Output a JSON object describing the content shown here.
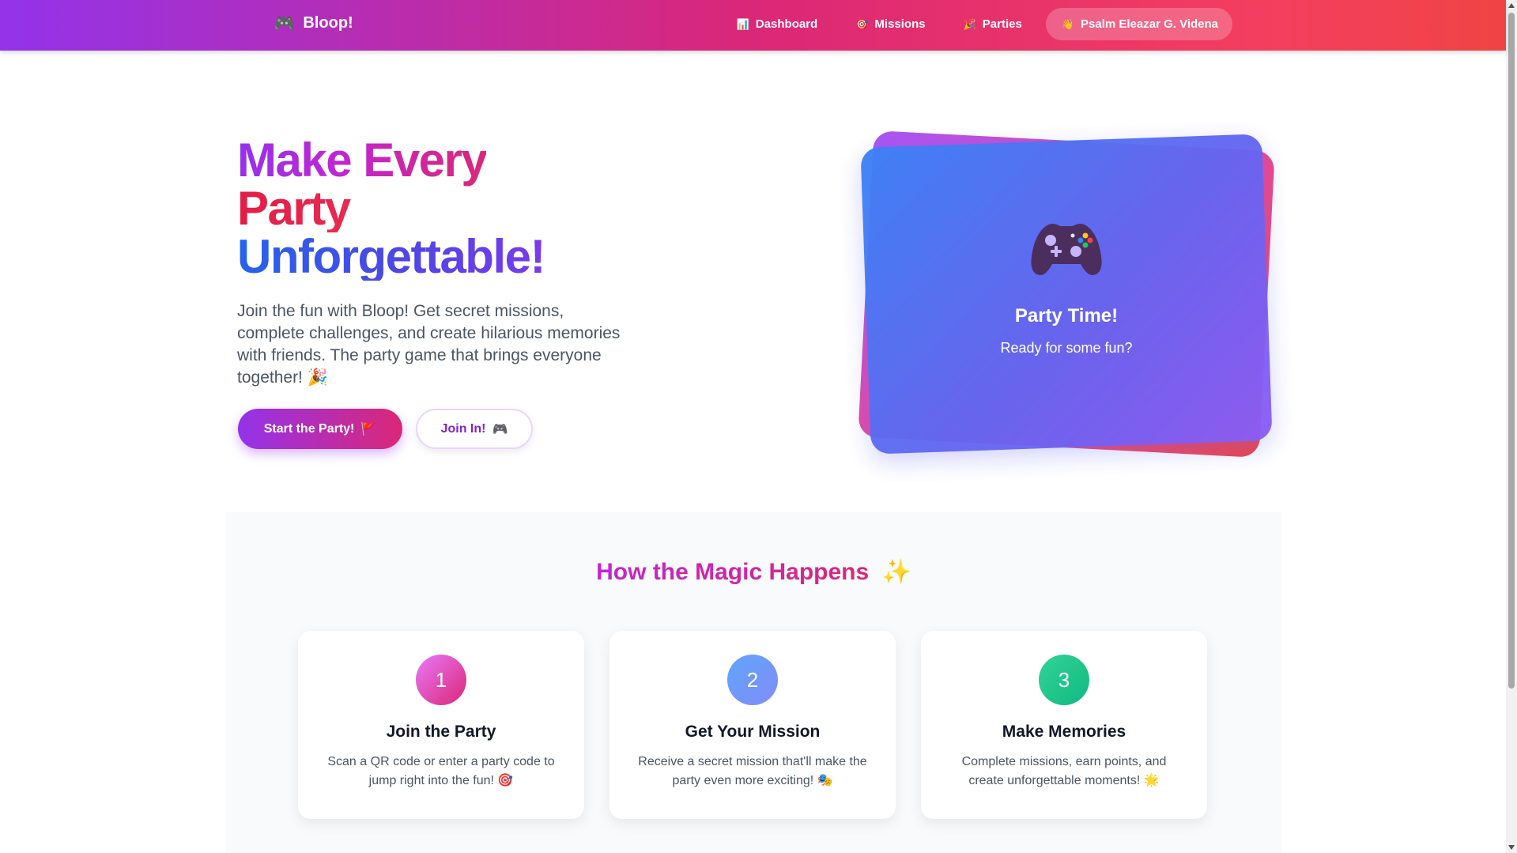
{
  "nav": {
    "brand_icon": "🎮",
    "brand_name": "Bloop!",
    "links": [
      {
        "icon": "📊",
        "label": "Dashboard"
      },
      {
        "icon": "🎯",
        "label": "Missions"
      },
      {
        "icon": "🎉",
        "label": "Parties"
      }
    ],
    "user": {
      "icon": "👋",
      "label": "Psalm Eleazar G. Videna"
    }
  },
  "hero": {
    "title_line1": "Make Every",
    "title_line2": "Party",
    "title_line3": "Unforgettable!",
    "description": "Join the fun with Bloop! Get secret missions, complete challenges, and create hilarious memories with friends. The party game that brings everyone together! 🎉",
    "primary_button": {
      "label": "Start the Party!",
      "icon": "🚩"
    },
    "secondary_button": {
      "label": "Join In!",
      "icon": "🎮"
    }
  },
  "hero_card": {
    "icon": "game-controller-icon",
    "title": "Party Time!",
    "subtitle": "Ready for some fun?"
  },
  "how": {
    "title": "How the Magic Happens",
    "title_icon": "✨",
    "steps": [
      {
        "number": "1",
        "title": "Join the Party",
        "description": "Scan a QR code or enter a party code to jump right into the fun! 🎯"
      },
      {
        "number": "2",
        "title": "Get Your Mission",
        "description": "Receive a secret mission that'll make the party even more exciting! 🎭"
      },
      {
        "number": "3",
        "title": "Make Memories",
        "description": "Complete missions, earn points, and create unforgettable moments! 🌟"
      }
    ]
  }
}
